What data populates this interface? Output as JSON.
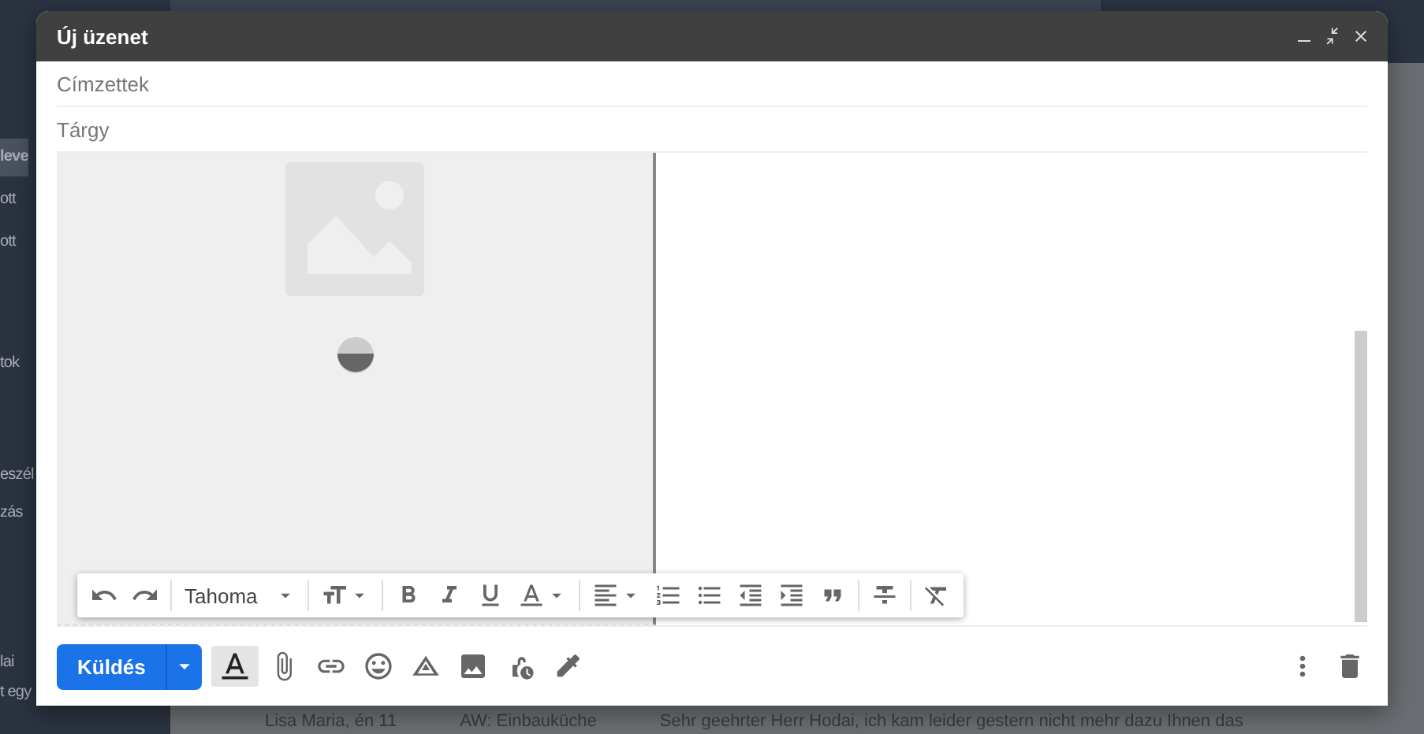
{
  "background": {
    "sidebar": {
      "items": [
        {
          "label": "leve",
          "selected": true
        },
        {
          "label": "ott",
          "selected": false
        },
        {
          "label": "ott",
          "selected": false
        },
        {
          "label": "tok",
          "selected": false
        },
        {
          "label": "eszél",
          "selected": false
        },
        {
          "label": "zás",
          "selected": false
        },
        {
          "label": "lai",
          "selected": false
        },
        {
          "label": "t egy",
          "selected": false
        }
      ]
    },
    "message_row": {
      "sender": "Lisa Maria, én 11",
      "subject": "AW: Einbauküche",
      "snippet": "Sehr geehrter Herr Hodai, ich kam leider gestern nicht mehr dazu Ihnen das"
    }
  },
  "compose": {
    "title": "Új üzenet",
    "recipients_field": {
      "placeholder": "Címzettek"
    },
    "subject_field": {
      "placeholder": "Tárgy"
    },
    "toolbar": {
      "font": "Tahoma"
    },
    "send_button": "Küldés",
    "formatting_toggle": {
      "on": true
    }
  }
}
